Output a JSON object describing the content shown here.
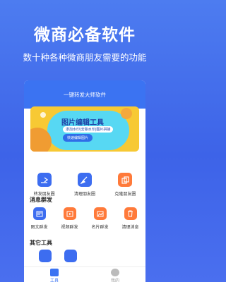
{
  "promo": {
    "title": "微商必备软件",
    "subtitle": "数十种各种微商朋友需要的功能"
  },
  "app": {
    "title": "一键转发大师软件",
    "banner": {
      "title": "图片编辑工具",
      "desc": "添加水印|去除水印|图片拼接",
      "button": "快速编辑图片"
    },
    "top_tools": [
      {
        "label": "转发朋友圈",
        "icon": "forward-icon",
        "color": "#3d6df0"
      },
      {
        "label": "清理朋友圈",
        "icon": "broom-icon",
        "color": "#3d6df0"
      },
      {
        "label": "克隆朋友圈",
        "icon": "clone-icon",
        "color": "#ff7a3a"
      }
    ],
    "section_group": "消息群发",
    "group_tools": [
      {
        "label": "图文群发",
        "icon": "image-text-icon",
        "color": "#3d6df0"
      },
      {
        "label": "视频群发",
        "icon": "video-icon",
        "color": "#ff7a3a"
      },
      {
        "label": "名片群发",
        "icon": "card-icon",
        "color": "#ff7a3a"
      },
      {
        "label": "清理消息",
        "icon": "trash-icon",
        "color": "#ff7a3a"
      }
    ],
    "section_other": "其它工具",
    "other_tools": [
      {
        "label": "",
        "icon": "tool-icon",
        "color": "#3d6df0"
      },
      {
        "label": "",
        "icon": "tool-icon",
        "color": "#3d6df0"
      }
    ],
    "tabs": [
      {
        "label": "工具",
        "active": true,
        "color": "#3b73f2"
      },
      {
        "label": "我的",
        "active": false,
        "color": "#bbbbbb"
      }
    ]
  }
}
